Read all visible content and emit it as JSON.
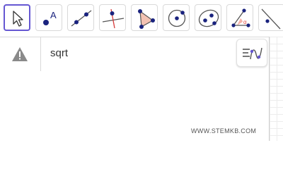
{
  "toolbar": {
    "tools": [
      {
        "name": "move-tool",
        "icon": "arrow-pointer-icon"
      },
      {
        "name": "point-tool",
        "icon": "point-icon",
        "label": "A"
      },
      {
        "name": "line-tool",
        "icon": "line-icon"
      },
      {
        "name": "perpendicular-line-tool",
        "icon": "perpendicular-icon"
      },
      {
        "name": "polygon-tool",
        "icon": "polygon-icon"
      },
      {
        "name": "circle-center-point-tool",
        "icon": "circle-icon"
      },
      {
        "name": "ellipse-tool",
        "icon": "ellipse-icon"
      },
      {
        "name": "angle-tool",
        "icon": "angle-icon",
        "label": "α"
      },
      {
        "name": "reflect-tool",
        "icon": "reflect-icon"
      }
    ],
    "selected_tool": "move-tool"
  },
  "input_bar": {
    "warning_icon": "warning-icon",
    "value": "sqrt",
    "style_bar_icon": "graphics-style-icon"
  },
  "graphics_view": {
    "watermark": "WWW.STEMKB.COM"
  },
  "colors": {
    "accent": "#6557d2",
    "point": "#1a237e",
    "perpendicular_red": "#d63b3b",
    "polygon_fill": "#f3c2b3",
    "angle_red": "#e0483e"
  }
}
